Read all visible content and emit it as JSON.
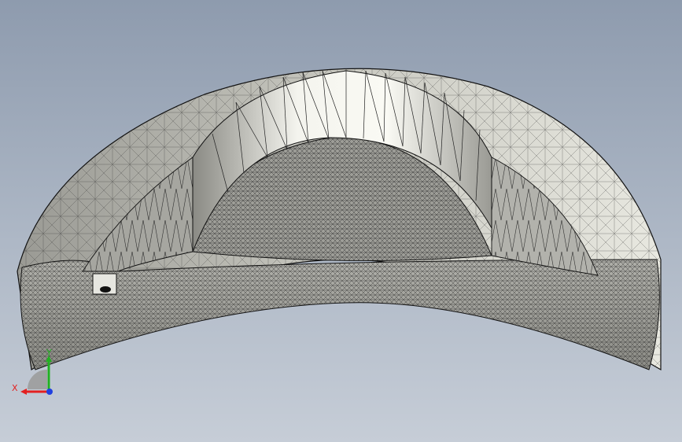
{
  "viewport": {
    "background_top": "#8e9bae",
    "background_bottom": "#c6cdd7"
  },
  "model": {
    "shape": "curved-shell-mesh",
    "fill_light": "#f2f2ec",
    "fill_mid": "#b9b9b2",
    "fill_dark": "#5a5a55",
    "edge_color": "#1a1a1a"
  },
  "triad": {
    "x_label": "X",
    "y_label": "Y",
    "x_color": "#e32020",
    "y_color": "#22b022",
    "z_color": "#2040e0"
  }
}
